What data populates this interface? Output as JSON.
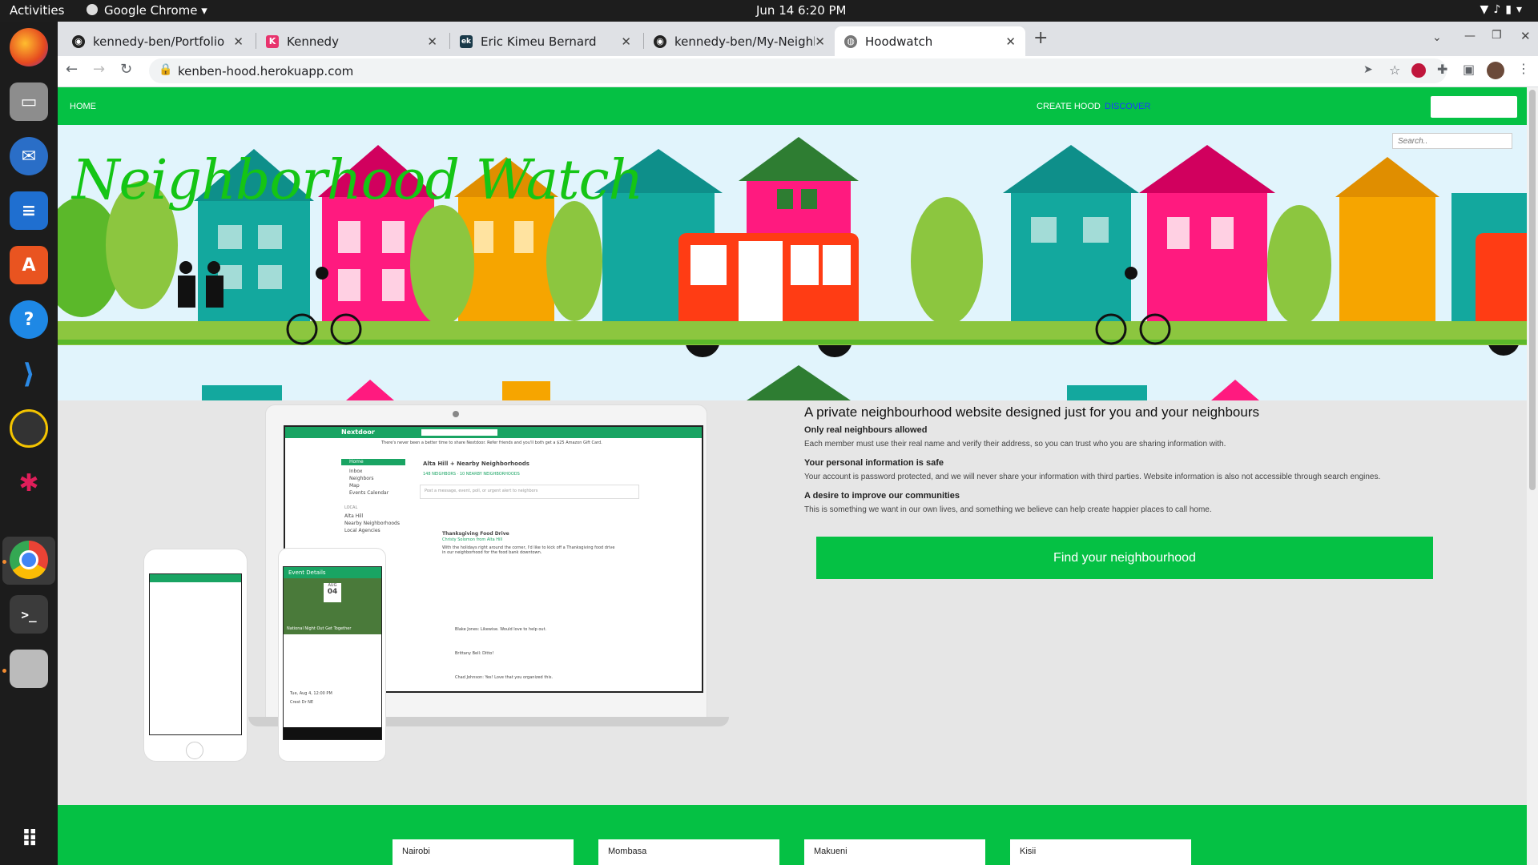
{
  "topbar": {
    "activities": "Activities",
    "app_menu": "Google Chrome ▾",
    "clock": "Jun 14  6:20 PM",
    "tray_icons": [
      "wifi-icon",
      "volume-icon",
      "battery-icon",
      "caret-down-icon"
    ]
  },
  "dock": {
    "items": [
      "firefox-icon",
      "files-icon",
      "thunderbird-icon",
      "writer-icon",
      "software-icon",
      "help-icon",
      "vscode-icon",
      "rhythmbox-icon",
      "slack-icon",
      "chrome-icon",
      "terminal-icon",
      "drive-icon",
      "apps-grid-icon"
    ]
  },
  "browser": {
    "tabs": [
      {
        "title": "kennedy-ben/Portfolio",
        "icon": "github-icon"
      },
      {
        "title": "Kennedy",
        "icon": "k-icon"
      },
      {
        "title": "Eric Kimeu Bernard",
        "icon": "ek-icon"
      },
      {
        "title": "kennedy-ben/My-Neighbo",
        "icon": "github-icon"
      },
      {
        "title": "Hoodwatch",
        "icon": "globe-icon"
      }
    ],
    "new_tab": "+",
    "url": "kenben-hood.herokuapp.com"
  },
  "site": {
    "nav": {
      "home": "HOME",
      "create": "CREATE HOOD",
      "discover": "DISCOVER"
    },
    "hero_title": "Neighborhood Watch",
    "search_placeholder": "Search..",
    "heading": "A private neighbourhood website designed just for you and your neighbours",
    "sections": [
      {
        "title": "Only real neighbours allowed",
        "body": "Each member must use their real name and verify their address, so you can trust who you are sharing information with."
      },
      {
        "title": "Your personal information is safe",
        "body": "Your account is password protected, and we will never share your information with third parties. Website information is also not accessible through search engines."
      },
      {
        "title": "A desire to improve our communities",
        "body": "This is something we want in our own lives, and something we believe can help create happier places to call home."
      }
    ],
    "cta": "Find your neighbourhood",
    "cities": [
      "Nairobi",
      "Mombasa",
      "Makueni",
      "Kisii"
    ],
    "mockup": {
      "brand": "Nextdoor",
      "search": "Search",
      "promo": "There's never been a better time to share Nextdoor. Refer friends and you'll both get a $25 Amazon Gift Card.",
      "menu": [
        "Home",
        "Inbox",
        "Neighbors",
        "Map",
        "Events Calendar"
      ],
      "local_title": "LOCAL",
      "local": [
        "Alta Hill",
        "Nearby Neighborhoods",
        "Local Agencies"
      ],
      "hood": "Alta Hill + Nearby Neighborhoods",
      "stats": "148 NEIGHBORS   ·   10 NEARBY NEIGHBORHOODS",
      "post_ph": "Post a message, event, poll, or urgent alert to neighbors",
      "post_title": "Thanksgiving Food Drive",
      "post_author": "Christy Solomon from Alta Hill",
      "post_body": "With the holidays right around the corner, I'd like to kick off a Thanksgiving food drive in our neighborhood for the food bank downtown.",
      "comments": [
        "Blake Jones: Likewise. Would love to help out.",
        "Brittany Bell: Ditto!",
        "Chad Johnson: Yes! Love that you organized this."
      ],
      "event_title": "Event Details",
      "event_month": "AUG",
      "event_day": "04",
      "event_name": "National Night Out Get Together",
      "event_date": "Tue, Aug 4, 12:00 PM",
      "event_place": "Crest Dr NE"
    }
  }
}
